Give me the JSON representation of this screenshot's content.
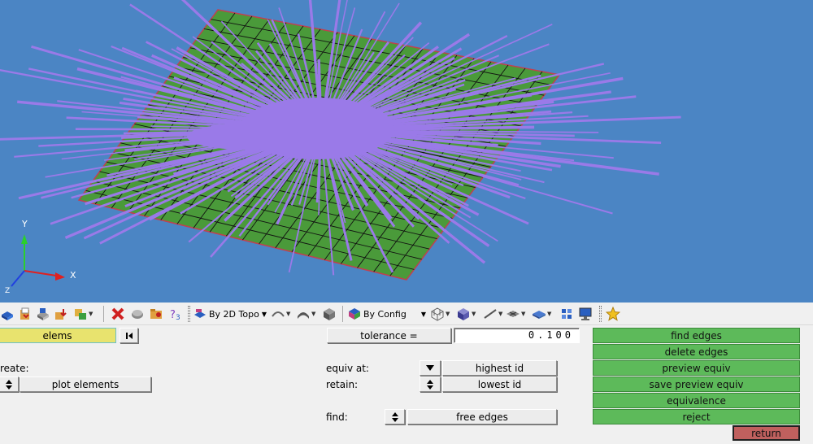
{
  "viewport": {
    "background": "#4b85c4",
    "mesh_fill": "#4a9a3a",
    "normals_color": "#9a7ae8",
    "axes": {
      "x_label": "X",
      "y_label": "Y",
      "z_label": "Z"
    }
  },
  "toolbar": {
    "icons_left": [
      "open-model-icon",
      "import-icon",
      "save-model-icon",
      "export-icon",
      "component-icon",
      "delete-icon",
      "mask-icon",
      "folder-icon",
      "help-icon"
    ],
    "topo_select": "By 2D Topo",
    "config_select": "By Config",
    "icons_right": [
      "wireframe-icon",
      "shaded-icon",
      "line-icon",
      "element-icon",
      "surface-icon",
      "palette-icon",
      "monitor-icon",
      "star-icon"
    ]
  },
  "panel": {
    "elems_label": "elems",
    "create_label": "reate:",
    "plot_elements_label": "plot elements",
    "tolerance_label": "tolerance =",
    "tolerance_value": "0.100",
    "equiv_at_label": "equiv at:",
    "equiv_at_value": "highest id",
    "retain_label": "retain:",
    "retain_value": "lowest id",
    "find_label": "find:",
    "find_value": "free edges",
    "actions": [
      "find edges",
      "delete edges",
      "preview equiv",
      "save preview equiv",
      "equivalence",
      "reject"
    ],
    "return_label": "return"
  }
}
